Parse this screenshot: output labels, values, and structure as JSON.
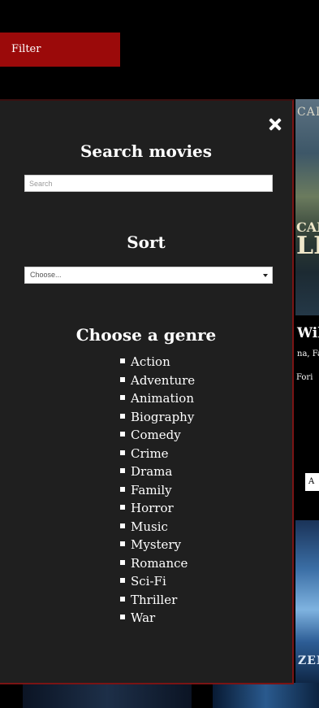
{
  "header": {
    "filter_label": "Filter"
  },
  "background": {
    "poster1_top_text": "CAI",
    "poster1_mid_text": "CAL",
    "poster1_big_text": "LL",
    "card_title": "Wil",
    "card_genres": "na, Fa",
    "card_line": "Fori",
    "card_button": "A",
    "poster2_text": "ZEN"
  },
  "panel": {
    "search_heading": "Search movies",
    "search_placeholder": "Search",
    "sort_heading": "Sort",
    "sort_selected": "Choose...",
    "genre_heading": "Choose a genre",
    "genres": [
      "Action",
      "Adventure",
      "Animation",
      "Biography",
      "Comedy",
      "Crime",
      "Drama",
      "Family",
      "Horror",
      "Music",
      "Mystery",
      "Romance",
      "Sci-Fi",
      "Thriller",
      "War"
    ]
  },
  "icons": {
    "close": "close-icon",
    "dropdown": "chevron-down-icon",
    "bullet": "square-bullet-icon"
  },
  "colors": {
    "accent": "#9b0a0a",
    "panel_bg": "#1f1f1f",
    "panel_border": "#7a1414",
    "page_bg": "#000000"
  }
}
